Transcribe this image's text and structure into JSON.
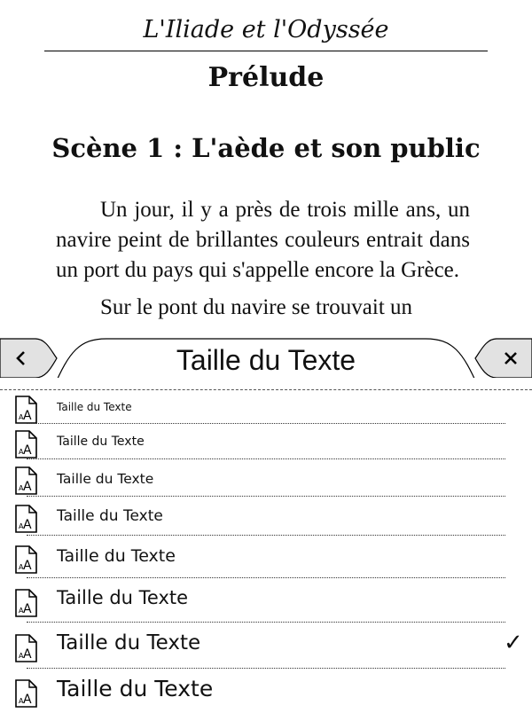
{
  "book": {
    "header": "L'Iliade et l'Odyssée",
    "chapter": "Prélude",
    "scene": "Scène 1 : L'aède et son public",
    "paragraph1": "Un jour, il y a près de trois mille ans, un navire peint de brillantes couleurs entrait dans un port du pays qui s'appelle encore la Grèce.",
    "paragraph2": "Sur le pont du navire se trouvait un"
  },
  "panel": {
    "title": "Taille du Texte",
    "back_icon": "chevron-left-icon",
    "close_icon": "close-icon",
    "options": [
      {
        "label": "Taille du Texte",
        "selected": false
      },
      {
        "label": "Taille du Texte",
        "selected": false
      },
      {
        "label": "Taille du Texte",
        "selected": false
      },
      {
        "label": "Taille du Texte",
        "selected": false
      },
      {
        "label": "Taille du Texte",
        "selected": false
      },
      {
        "label": "Taille du Texte",
        "selected": false
      },
      {
        "label": "Taille du Texte",
        "selected": true
      },
      {
        "label": "Taille du Texte",
        "selected": false
      }
    ],
    "check_mark": "✓"
  }
}
